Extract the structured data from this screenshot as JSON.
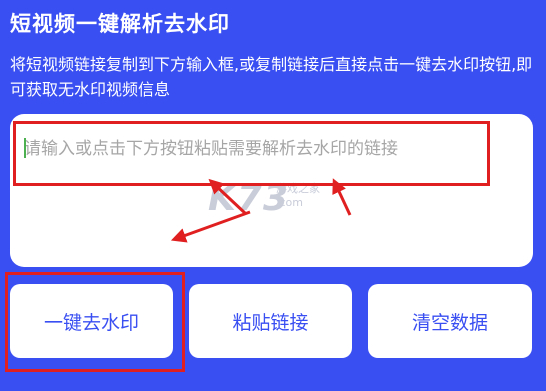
{
  "header": {
    "title": "短视频一键解析去水印",
    "description": "将短视频链接复制到下方输入框,或复制链接后直接点击一键去水印按钮,即可获取无水印视频信息"
  },
  "input": {
    "value": "",
    "placeholder": "请输入或点击下方按钮粘贴需要解析去水印的链接"
  },
  "buttons": {
    "remove_watermark": "一键去水印",
    "paste_link": "粘贴链接",
    "clear_data": "清空数据"
  },
  "watermark": {
    "logo": "K73",
    "tagline": "游戏之家",
    "domain": ".com"
  },
  "colors": {
    "background": "#3a4ff2",
    "button_text": "#3a4ff2",
    "highlight": "#e02020"
  }
}
